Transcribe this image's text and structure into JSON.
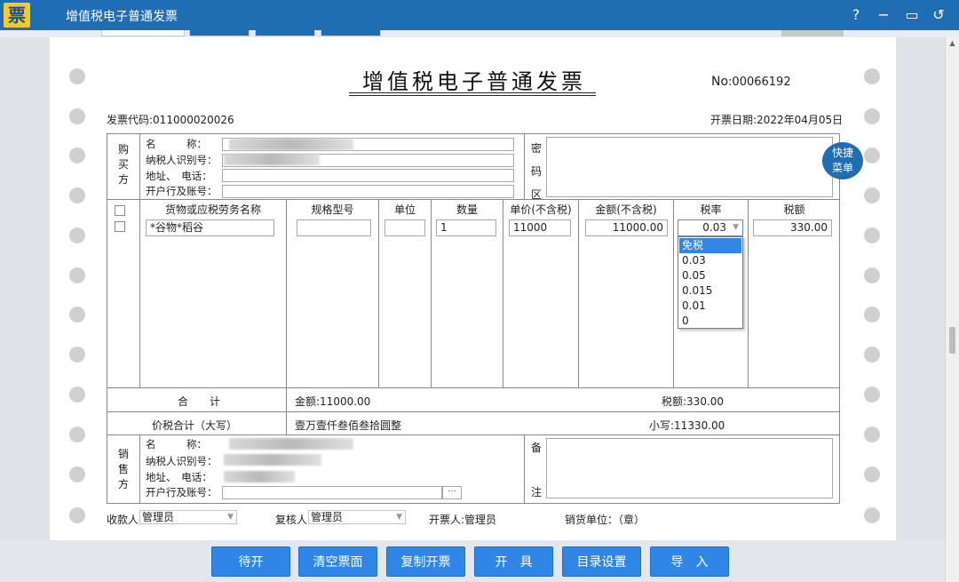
{
  "window": {
    "title": "增值税电子普通发票",
    "logo_char": "票"
  },
  "window_controls": {
    "help": "?",
    "minimize": "−",
    "restore": "▭",
    "back": "↺"
  },
  "invoice": {
    "title": "增值税电子普通发票",
    "no_label": "No",
    "no_value": ":00066192",
    "code_label": "发票代码:",
    "code_value": "011000020026",
    "date_label": "开票日期:",
    "date_value": "2022年04月05日"
  },
  "buyer": {
    "section_label": [
      "购",
      "买",
      "方"
    ],
    "name_label": "名　　　称：",
    "tax_id_label": "纳税人识别号：",
    "address_label": "地址、　电话：",
    "bank_label": "开户行及账号："
  },
  "password_area": {
    "label": [
      "密",
      "码",
      "区"
    ]
  },
  "quick_menu": {
    "line1": "快捷",
    "line2": "菜单"
  },
  "items_table": {
    "headers": [
      "货物或应税劳务名称",
      "规格型号",
      "单位",
      "数量",
      "单价(不含税)",
      "金额(不含税)",
      "税率",
      "税额"
    ],
    "row": {
      "name": "*谷物*稻谷",
      "spec": "",
      "unit": "",
      "quantity": "1",
      "unit_price": "11000",
      "amount": "11000.00",
      "tax_rate": "0.03",
      "tax_amount": "330.00"
    },
    "tax_rate_options": [
      "免税",
      "0.03",
      "0.05",
      "0.015",
      "0.01",
      "0"
    ],
    "tax_rate_highlighted": "免税"
  },
  "totals": {
    "label": "合　　计",
    "amount_text": "金额:11000.00",
    "tax_text": "税额:330.00",
    "total_label": "价税合计（大写）",
    "total_upper": "壹万壹仟叁佰叁拾圆整",
    "total_lower": "小写:11330.00"
  },
  "seller": {
    "section_label": [
      "销",
      "售",
      "方"
    ],
    "name_label": "名　　　称：",
    "tax_id_label": "纳税人识别号：",
    "address_label": "地址、　电话：",
    "bank_label": "开户行及账号：",
    "bank_button": "···"
  },
  "remarks": {
    "label_top": "备",
    "label_bottom": "注"
  },
  "signatures": {
    "payee_label": "收款人:",
    "payee_value": "管理员",
    "reviewer_label": "复核人:",
    "reviewer_value": "管理员",
    "issuer_text": "开票人:管理员",
    "seller_seal_text": "销货单位：（章）"
  },
  "actions": [
    "待开",
    "清空票面",
    "复制开票",
    "开　具",
    "目录设置",
    "导　入"
  ],
  "colors": {
    "titlebar": "#1f6db2",
    "button": "#2f86e6",
    "highlight": "#2f86e6"
  }
}
